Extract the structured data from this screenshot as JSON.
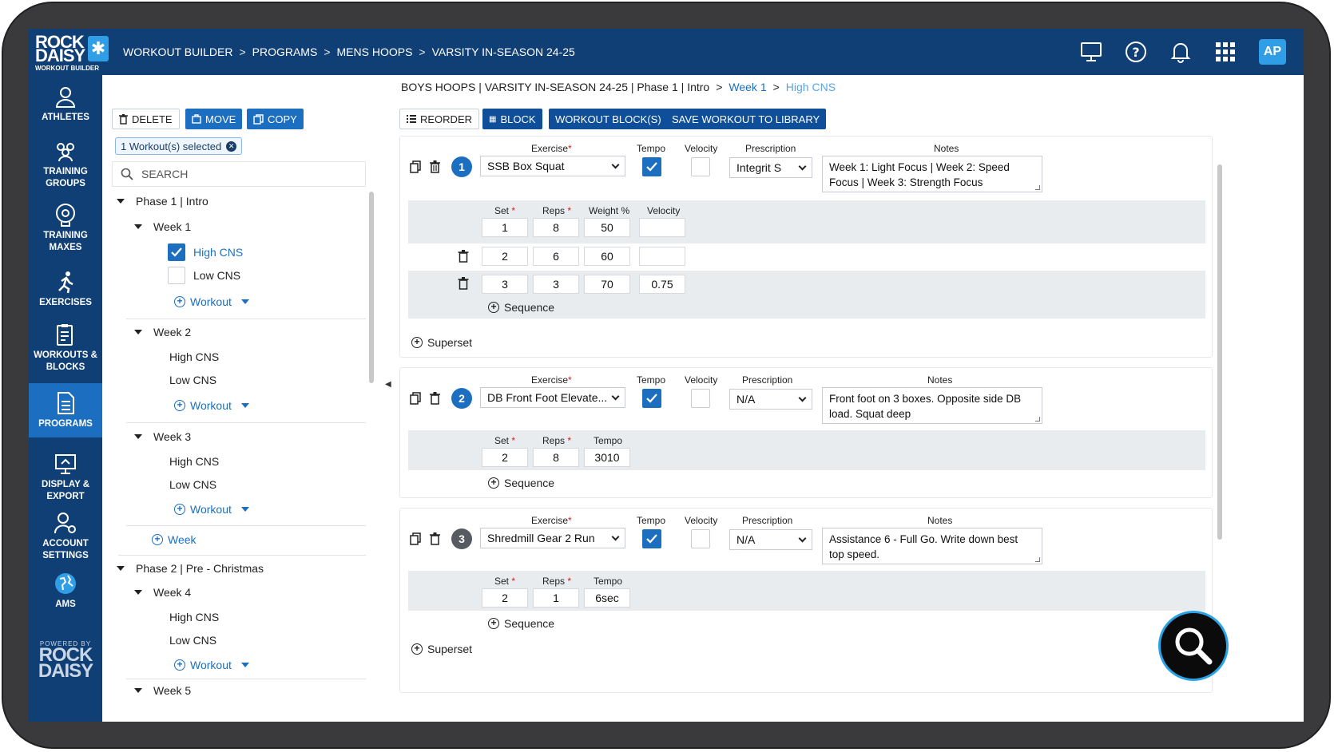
{
  "brand": {
    "logo_line1": "ROCK",
    "logo_line2": "DAISY",
    "logo_line3": "WORKOUT BUILDER",
    "powered_by": "POWERED BY",
    "powered_line1": "ROCK",
    "powered_line2": "DAISY"
  },
  "breadcrumb": [
    "WORKOUT BUILDER",
    "PROGRAMS",
    "MENS HOOPS",
    "VARSITY IN-SEASON 24-25"
  ],
  "header": {
    "avatar_initials": "AP"
  },
  "nav": [
    {
      "label": "ATHLETES",
      "icon": "person-icon"
    },
    {
      "label": "TRAINING GROUPS",
      "icon": "group-icon"
    },
    {
      "label": "TRAINING MAXES",
      "icon": "gauge-icon"
    },
    {
      "label": "EXERCISES",
      "icon": "runner-icon"
    },
    {
      "label": "WORKOUTS & BLOCKS",
      "icon": "clipboard-icon"
    },
    {
      "label": "PROGRAMS",
      "icon": "document-icon"
    },
    {
      "label": "DISPLAY & EXPORT",
      "icon": "monitor-icon"
    },
    {
      "label": "ACCOUNT SETTINGS",
      "icon": "user-gear-icon"
    },
    {
      "label": "AMS",
      "icon": "globe-icon"
    }
  ],
  "tree_toolbar": {
    "delete": "DELETE",
    "move": "MOVE",
    "copy": "COPY"
  },
  "selection": "1 Workout(s) selected",
  "search_placeholder": "SEARCH",
  "tree": {
    "phase1": "Phase 1 | Intro",
    "week1": "Week 1",
    "w1_high": "High CNS",
    "w1_low": "Low CNS",
    "workout": "Workout",
    "week2": "Week 2",
    "w2_high": "High CNS",
    "w2_low": "Low CNS",
    "week3": "Week 3",
    "w3_high": "High CNS",
    "w3_low": "Low CNS",
    "add_week": "Week",
    "phase2": "Phase 2 | Pre - Christmas",
    "week4": "Week 4",
    "w4_high": "High CNS",
    "w4_low": "Low CNS",
    "week5": "Week 5"
  },
  "main_crumb": {
    "path": "BOYS HOOPS | VARSITY IN-SEASON 24-25 | Phase 1 | Intro",
    "week": "Week 1",
    "workout": "High CNS"
  },
  "main_toolbar": {
    "reorder": "REORDER",
    "block": "BLOCK",
    "workout_blocks": "WORKOUT BLOCK(S)",
    "save": "SAVE WORKOUT TO LIBRARY"
  },
  "labels": {
    "exercise": "Exercise",
    "tempo": "Tempo",
    "velocity": "Velocity",
    "prescription": "Prescription",
    "notes": "Notes",
    "set": "Set",
    "reps": "Reps",
    "weight": "Weight %",
    "velocity_col": "Velocity",
    "tempo_col": "Tempo",
    "sequence": "Sequence",
    "superset": "Superset",
    "asterisk": "*"
  },
  "exercises": [
    {
      "num": "1",
      "name": "SSB Box Squat",
      "tempo_checked": true,
      "velocity_checked": false,
      "prescription": "Integrit S",
      "notes": "Week 1: Light Focus | Week 2: Speed Focus | Week 3: Strength Focus",
      "sets": [
        {
          "set": "1",
          "reps": "8",
          "weight": "50",
          "velocity": ""
        },
        {
          "set": "2",
          "reps": "6",
          "weight": "60",
          "velocity": ""
        },
        {
          "set": "3",
          "reps": "3",
          "weight": "70",
          "velocity": "0.75"
        }
      ]
    },
    {
      "num": "2",
      "name": "DB Front Foot Elevate...",
      "tempo_checked": true,
      "velocity_checked": false,
      "prescription": "N/A",
      "notes": "Front foot on 3 boxes. Opposite side DB load. Squat deep",
      "sets": [
        {
          "set": "2",
          "reps": "8",
          "tempo": "3010"
        }
      ]
    },
    {
      "num": "3",
      "name": "Shredmill Gear 2 Run",
      "tempo_checked": true,
      "velocity_checked": false,
      "prescription": "N/A",
      "notes": "Assistance 6 - Full Go. Write down best top speed.",
      "sets": [
        {
          "set": "2",
          "reps": "1",
          "tempo": "6sec"
        }
      ]
    }
  ],
  "colors": {
    "navy": "#0f3f75",
    "accent": "#1c6fc0",
    "active_nav": "#1c6fc0"
  }
}
